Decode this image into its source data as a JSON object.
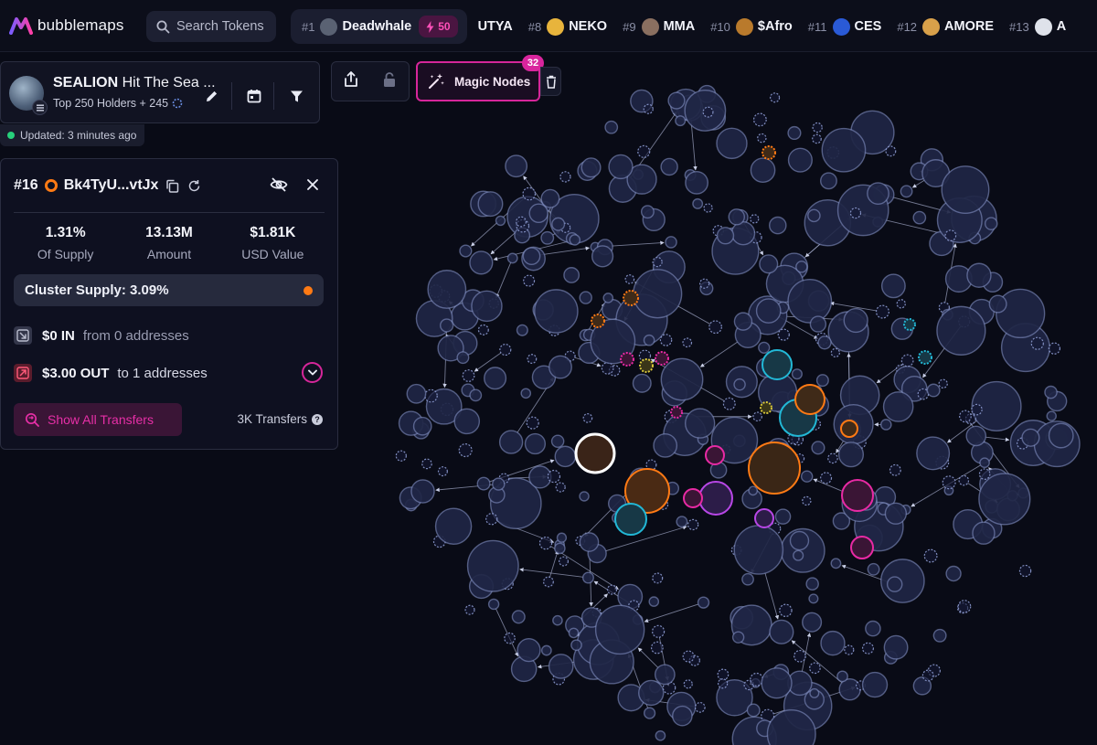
{
  "brand": {
    "name": "bubblemaps"
  },
  "search": {
    "placeholder": "Search Tokens"
  },
  "trending": {
    "first": {
      "rank": "#1",
      "name": "Deadwhale",
      "boost": "50",
      "avatar": "#5a6273"
    },
    "items": [
      {
        "rank": "",
        "name": "UTYA",
        "avatar": ""
      },
      {
        "rank": "#8",
        "name": "NEKO",
        "avatar": "#e8b43c"
      },
      {
        "rank": "#9",
        "name": "MMA",
        "avatar": "#8a6f60"
      },
      {
        "rank": "#10",
        "name": "$Afro",
        "avatar": "#b97a2c"
      },
      {
        "rank": "#11",
        "name": "CES",
        "avatar": "#2a5ad6"
      },
      {
        "rank": "#12",
        "name": "AMORE",
        "avatar": "#d8a04a"
      },
      {
        "rank": "#13",
        "name": "A",
        "avatar": "#dfe2ea"
      }
    ]
  },
  "token": {
    "symbol": "SEALION",
    "name": "Hit The Sea ...",
    "subtitle": "Top 250 Holders + 245",
    "updated": "Updated: 3 minutes ago"
  },
  "toolbar": {
    "magic_label": "Magic Nodes",
    "magic_count": "32"
  },
  "wallet": {
    "rank": "#16",
    "address": "Bk4TyU...vtJx",
    "stats": [
      {
        "value": "1.31%",
        "label": "Of Supply"
      },
      {
        "value": "13.13M",
        "label": "Amount"
      },
      {
        "value": "$1.81K",
        "label": "USD Value"
      }
    ],
    "cluster_supply": "Cluster Supply: 3.09%",
    "in": {
      "amount": "$0 IN",
      "text": "from 0 addresses"
    },
    "out": {
      "amount": "$3.00 OUT",
      "text": "to 1 addresses"
    },
    "show_all_label": "Show All Transfers",
    "transfers_count": "3K Transfers"
  },
  "colors": {
    "accent": "#e72fa7",
    "cluster_orange": "#ff7a14",
    "node_default": "#8d9bd0",
    "node_cyan": "#22b8d6",
    "node_magenta": "#e82aa4",
    "node_yellow": "#d8c73a",
    "node_purple": "#b847e6"
  },
  "icons": {
    "search": "search-icon",
    "pencil": "pencil-icon",
    "calendar": "calendar-icon",
    "filter": "filter-icon",
    "share": "share-icon",
    "lock": "lock-icon",
    "wand": "magic-wand-icon",
    "trash": "trash-icon",
    "copy": "copy-icon",
    "refresh": "refresh-icon",
    "eye_off": "eye-off-icon",
    "close": "close-icon"
  }
}
